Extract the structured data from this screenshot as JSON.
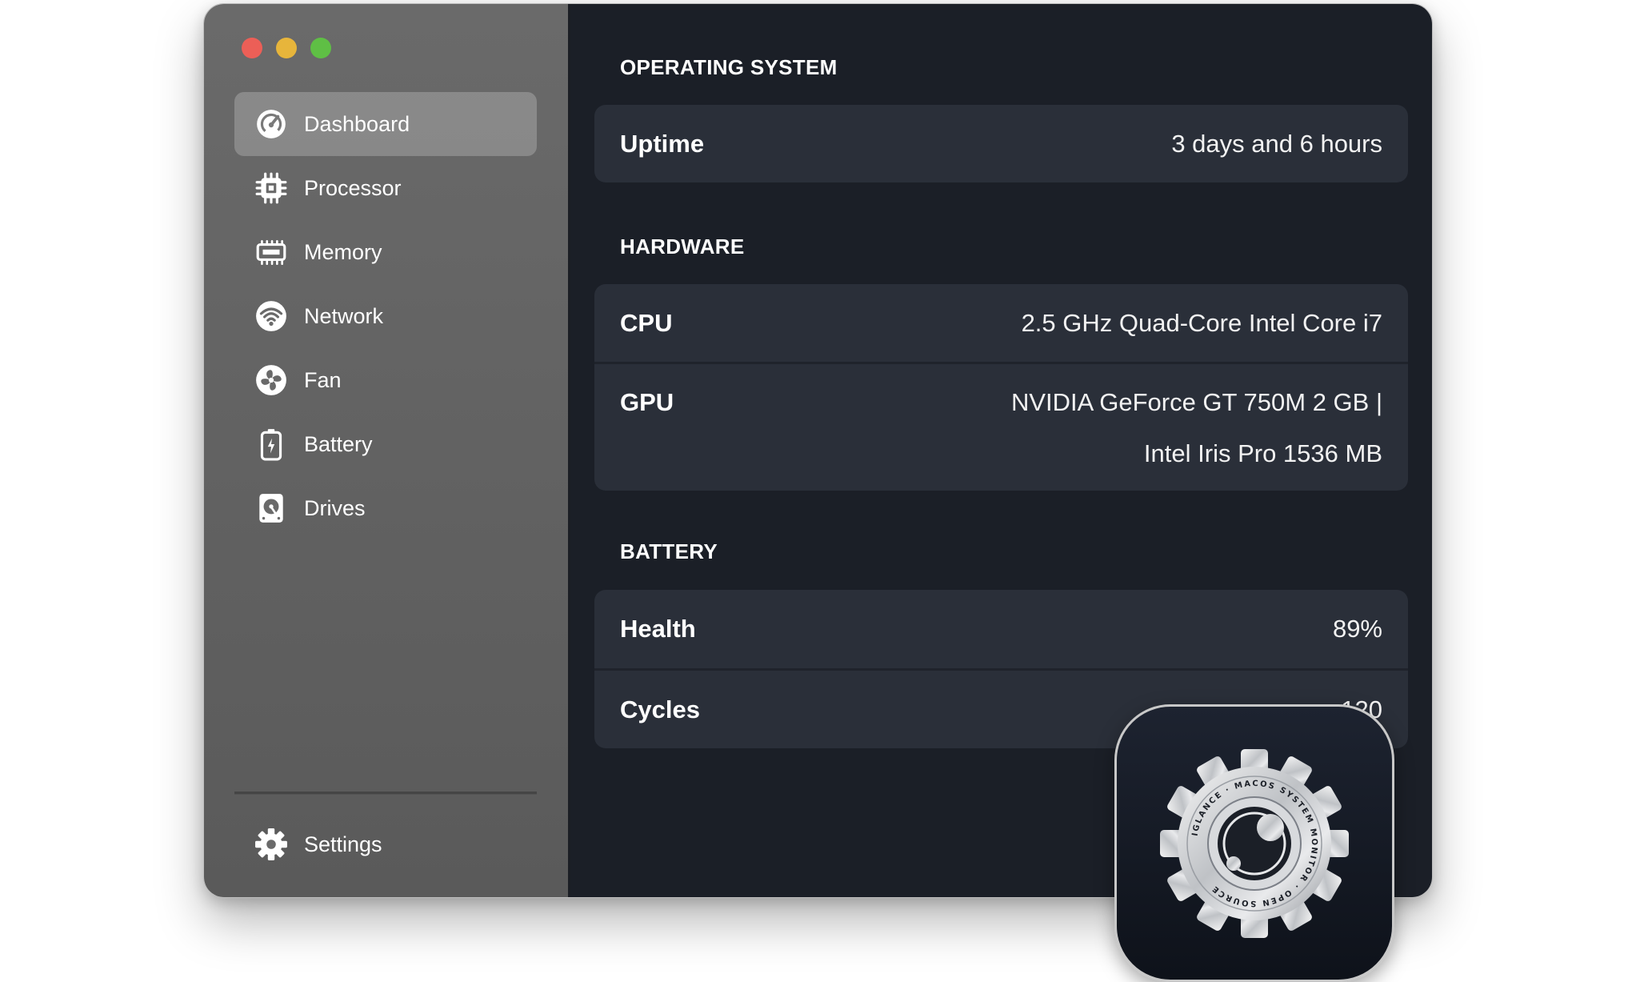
{
  "window": {
    "traffic_lights": [
      "#ec5f57",
      "#e7b53b",
      "#5fbf45"
    ]
  },
  "sidebar": {
    "items": [
      {
        "label": "Dashboard",
        "icon": "dashboard-gauge-icon",
        "active": true
      },
      {
        "label": "Processor",
        "icon": "processor-chip-icon",
        "active": false
      },
      {
        "label": "Memory",
        "icon": "memory-module-icon",
        "active": false
      },
      {
        "label": "Network",
        "icon": "wifi-icon",
        "active": false
      },
      {
        "label": "Fan",
        "icon": "fan-icon",
        "active": false
      },
      {
        "label": "Battery",
        "icon": "battery-icon",
        "active": false
      },
      {
        "label": "Drives",
        "icon": "hard-drive-icon",
        "active": false
      }
    ],
    "settings": {
      "label": "Settings",
      "icon": "gear-icon"
    }
  },
  "main": {
    "sections": [
      {
        "title": "OPERATING SYSTEM",
        "rows": [
          {
            "label": "Uptime",
            "value": "3 days and 6 hours"
          }
        ]
      },
      {
        "title": "HARDWARE",
        "rows": [
          {
            "label": "CPU",
            "value": "2.5 GHz Quad-Core Intel Core i7"
          },
          {
            "label": "GPU",
            "value_line1": "NVIDIA GeForce GT 750M 2 GB |",
            "value_line2": "Intel Iris Pro 1536 MB"
          }
        ]
      },
      {
        "title": "BATTERY",
        "rows": [
          {
            "label": "Health",
            "value": "89%"
          },
          {
            "label": "Cycles",
            "value": "120"
          }
        ]
      }
    ]
  },
  "app_icon": {
    "ring_text": "IGLANCE · MACOS SYSTEM MONITOR · OPEN SOURCE",
    "icon": "gear-eye-icon"
  },
  "colors": {
    "sidebar_bg": "#636363",
    "main_bg": "#1b1f27",
    "card_bg": "#2a2f39",
    "text": "#ffffff"
  }
}
